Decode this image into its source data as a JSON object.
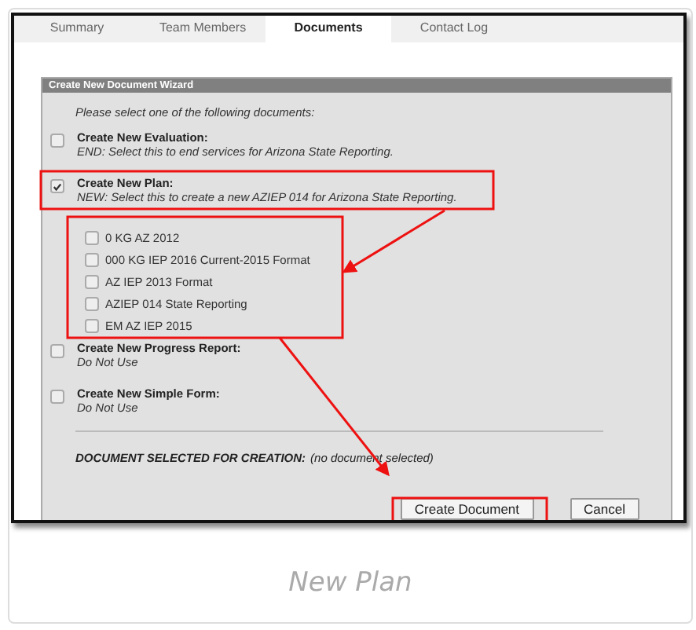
{
  "tabs": [
    {
      "label": "Summary",
      "selected": false
    },
    {
      "label": "Team Members",
      "selected": false
    },
    {
      "label": "Documents",
      "selected": true
    },
    {
      "label": "Contact Log",
      "selected": false
    }
  ],
  "wizard": {
    "title": "Create New Document Wizard",
    "prompt": "Please select one of the following documents:",
    "options": [
      {
        "title": "Create New Evaluation:",
        "description": "END: Select this to end services for Arizona State Reporting.",
        "checked": false
      },
      {
        "title": "Create New Plan:",
        "description": "NEW: Select this to create a new AZIEP 014 for Arizona State Reporting.",
        "checked": true,
        "children": [
          {
            "label": "0 KG AZ 2012",
            "checked": false
          },
          {
            "label": "000 KG IEP 2016 Current-2015 Format",
            "checked": false
          },
          {
            "label": "AZ IEP 2013 Format",
            "checked": false
          },
          {
            "label": "AZIEP 014 State Reporting",
            "checked": false
          },
          {
            "label": "EM AZ IEP 2015",
            "checked": false
          }
        ]
      },
      {
        "title": "Create New Progress Report:",
        "description": "Do Not Use",
        "checked": false
      },
      {
        "title": "Create New Simple Form:",
        "description": "Do Not Use",
        "checked": false
      }
    ],
    "selection_label": "DOCUMENT SELECTED FOR CREATION:",
    "selection_value": "(no document selected)",
    "buttons": [
      "Create Document",
      "Cancel"
    ]
  },
  "caption": "New Plan"
}
